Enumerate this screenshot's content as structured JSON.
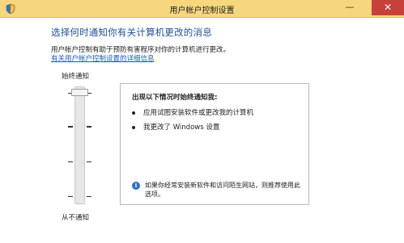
{
  "window": {
    "title": "用户帐户控制设置",
    "minimize_glyph": "—",
    "maximize_glyph": "□",
    "close_glyph": "✕"
  },
  "main": {
    "heading": "选择何时通知你有关计算机更改的消息",
    "description": "用户帐户控制有助于预防有害程序对你的计算机进行更改。",
    "help_link": "有关用户帐户控制设置的详细信息"
  },
  "slider": {
    "top_label": "始终通知",
    "bottom_label": "从不通知",
    "levels": 4,
    "selected_level": 4
  },
  "panel": {
    "title": "出现以下情况时始终通知我:",
    "bullets": [
      "应用试图安装软件或更改我的计算机",
      "我更改了 Windows 设置"
    ],
    "note": "如果你经常安装新软件和访问陌生网站，则推荐使用此选项。"
  },
  "colors": {
    "titlebar": "#f7d77e",
    "heading": "#1b4f9e",
    "link": "#1a5db8",
    "close": "#c7403a"
  }
}
